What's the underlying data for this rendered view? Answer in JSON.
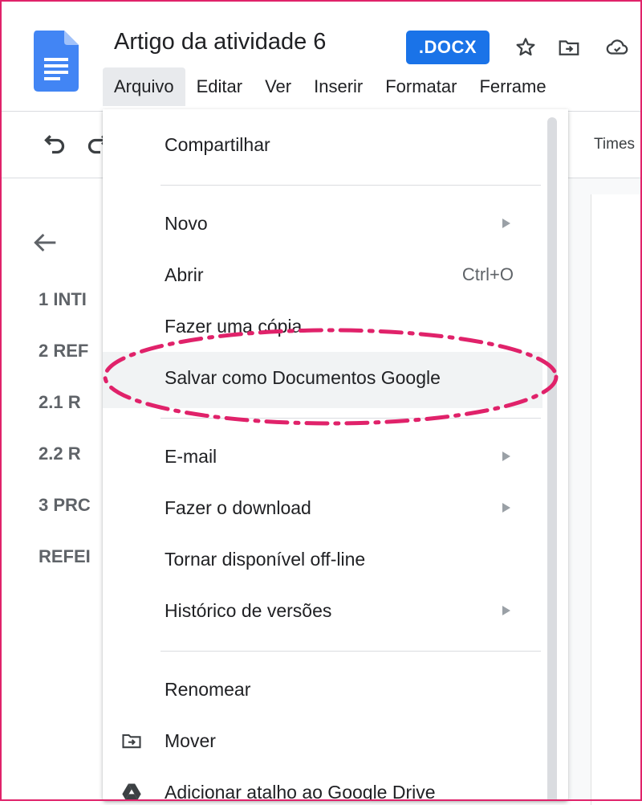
{
  "header": {
    "title": "Artigo da atividade 6",
    "badge": ".DOCX",
    "icons": [
      "star-icon",
      "move-to-folder-icon",
      "cloud-saved-icon"
    ]
  },
  "menubar": {
    "items": [
      "Arquivo",
      "Editar",
      "Ver",
      "Inserir",
      "Formatar",
      "Ferrame"
    ]
  },
  "toolbar": {
    "font": "Times",
    "icons": [
      "undo-icon",
      "redo-icon"
    ]
  },
  "outline": {
    "back_icon": "arrow-back-icon",
    "items": [
      "1 INTI",
      "2 REF",
      "2.1 R",
      "2.2 R",
      "3 PRC",
      "REFEI"
    ]
  },
  "menu": {
    "items": [
      {
        "label": "Compartilhar"
      },
      {
        "label": "Novo",
        "submenu": true
      },
      {
        "label": "Abrir",
        "shortcut": "Ctrl+O"
      },
      {
        "label": "Fazer uma cópia"
      },
      {
        "label": "Salvar como Documentos Google",
        "highlighted": true
      },
      {
        "label": "E-mail",
        "submenu": true
      },
      {
        "label": "Fazer o download",
        "submenu": true
      },
      {
        "label": "Tornar disponível off-line"
      },
      {
        "label": "Histórico de versões",
        "submenu": true
      },
      {
        "label": "Renomear"
      },
      {
        "label": "Mover",
        "icon": "move-folder-icon"
      },
      {
        "label": "Adicionar atalho ao Google Drive",
        "icon": "google-drive-shortcut-icon"
      }
    ]
  },
  "colors": {
    "accent": "#1a73e8",
    "annotation": "#e0226a",
    "highlight": "#f1f3f4"
  }
}
